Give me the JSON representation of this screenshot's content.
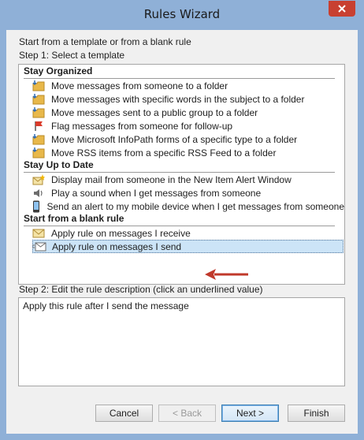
{
  "window": {
    "title": "Rules Wizard"
  },
  "intro": "Start from a template or from a blank rule",
  "step1": {
    "label": "Step 1: Select a template"
  },
  "groups": [
    {
      "name": "Stay Organized",
      "items": [
        {
          "label": "Move messages from someone to a folder",
          "icon": "folder-icon"
        },
        {
          "label": "Move messages with specific words in the subject to a folder",
          "icon": "folder-icon"
        },
        {
          "label": "Move messages sent to a public group to a folder",
          "icon": "folder-icon"
        },
        {
          "label": "Flag messages from someone for follow-up",
          "icon": "flag-icon"
        },
        {
          "label": "Move Microsoft InfoPath forms of a specific type to a folder",
          "icon": "folder-icon"
        },
        {
          "label": "Move RSS items from a specific RSS Feed to a folder",
          "icon": "folder-icon"
        }
      ]
    },
    {
      "name": "Stay Up to Date",
      "items": [
        {
          "label": "Display mail from someone in the New Item Alert Window",
          "icon": "alert-mail-icon"
        },
        {
          "label": "Play a sound when I get messages from someone",
          "icon": "speaker-icon"
        },
        {
          "label": "Send an alert to my mobile device when I get messages from someone",
          "icon": "mobile-icon"
        }
      ]
    },
    {
      "name": "Start from a blank rule",
      "items": [
        {
          "label": "Apply rule on messages I receive",
          "icon": "envelope-icon"
        },
        {
          "label": "Apply rule on messages I send",
          "icon": "send-envelope-icon",
          "selected": true
        }
      ]
    }
  ],
  "step2": {
    "label": "Step 2: Edit the rule description (click an underlined value)",
    "description": "Apply this rule after I send the message"
  },
  "buttons": {
    "cancel": "Cancel",
    "back": "< Back",
    "next": "Next >",
    "finish": "Finish"
  },
  "colors": {
    "selection": "#cce4f7",
    "arrow": "#c0392b",
    "frame": "#8fb0d7"
  }
}
